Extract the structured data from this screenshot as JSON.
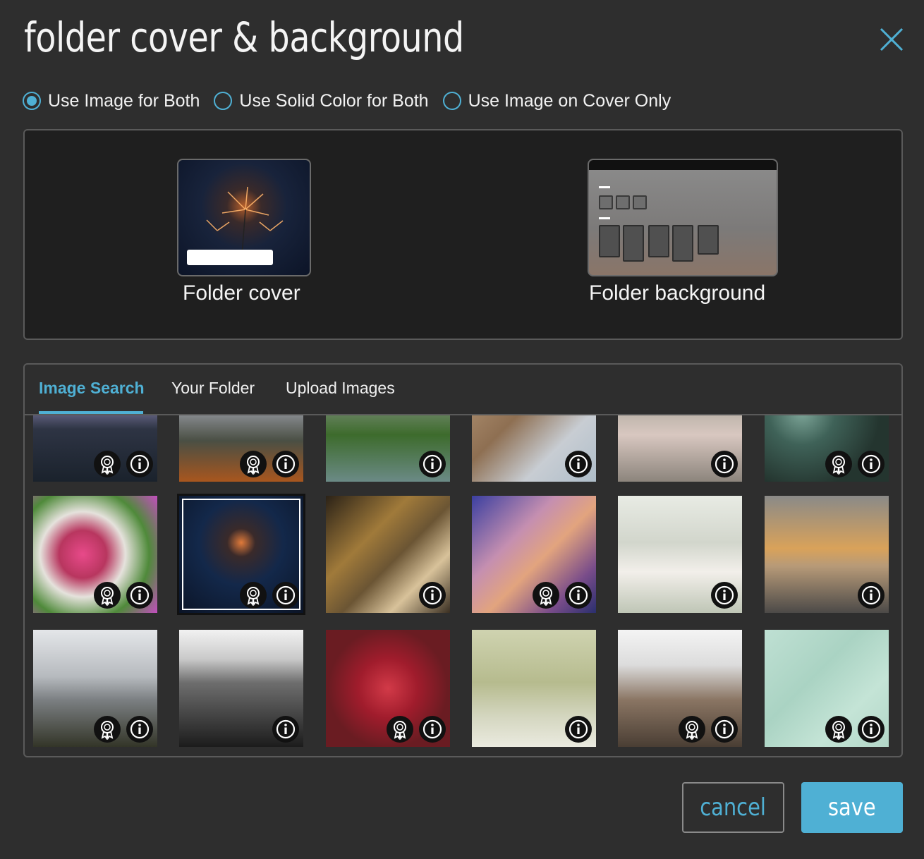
{
  "dialog": {
    "title": "folder cover & background",
    "options": [
      {
        "label": "Use Image for Both",
        "selected": true
      },
      {
        "label": "Use Solid Color for Both",
        "selected": false
      },
      {
        "label": "Use Image on Cover Only",
        "selected": false
      }
    ],
    "preview": {
      "cover_label": "Folder cover",
      "background_label": "Folder background"
    },
    "tabs": [
      {
        "label": "Image Search",
        "active": true
      },
      {
        "label": "Your Folder",
        "active": false
      },
      {
        "label": "Upload Images",
        "active": false
      }
    ],
    "cancel_label": "cancel",
    "save_label": "save"
  },
  "colors": {
    "accent": "#4fb0d4",
    "background": "#2e2e2e",
    "panel": "#1f1f1f"
  },
  "icons": {
    "close": "close-icon",
    "award": "award-ribbon-icon",
    "info": "info-icon"
  },
  "images": [
    {
      "subject": "mountains-purple-sky",
      "award": true,
      "selected": false
    },
    {
      "subject": "mountains-autumn-valley",
      "award": true,
      "selected": false
    },
    {
      "subject": "green-mountain-lake",
      "award": false,
      "selected": false
    },
    {
      "subject": "building-facade",
      "award": false,
      "selected": false
    },
    {
      "subject": "man-striped-shirt",
      "award": false,
      "selected": false
    },
    {
      "subject": "succulents",
      "award": true,
      "selected": false
    },
    {
      "subject": "tulips",
      "award": true,
      "selected": false
    },
    {
      "subject": "sparklers",
      "award": true,
      "selected": true
    },
    {
      "subject": "arched-interior",
      "award": false,
      "selected": false
    },
    {
      "subject": "antelope-canyon",
      "award": true,
      "selected": false
    },
    {
      "subject": "woman-white-dress",
      "award": false,
      "selected": false
    },
    {
      "subject": "sunset-sea-boat",
      "award": false,
      "selected": false
    },
    {
      "subject": "snowy-mountains",
      "award": true,
      "selected": false
    },
    {
      "subject": "bw-portrait",
      "award": false,
      "selected": false
    },
    {
      "subject": "red-apples",
      "award": true,
      "selected": false
    },
    {
      "subject": "yellow-bird",
      "award": false,
      "selected": false
    },
    {
      "subject": "snow-rock-hills",
      "award": true,
      "selected": false
    },
    {
      "subject": "pink-flowers",
      "award": true,
      "selected": false
    }
  ]
}
